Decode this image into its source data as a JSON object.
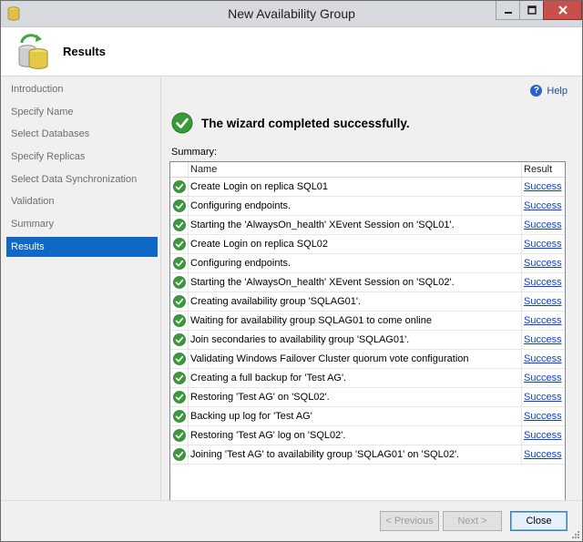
{
  "window": {
    "title": "New Availability Group"
  },
  "header": {
    "title": "Results"
  },
  "sidebar": {
    "items": [
      {
        "label": "Introduction",
        "selected": false
      },
      {
        "label": "Specify Name",
        "selected": false
      },
      {
        "label": "Select Databases",
        "selected": false
      },
      {
        "label": "Specify Replicas",
        "selected": false
      },
      {
        "label": "Select Data Synchronization",
        "selected": false
      },
      {
        "label": "Validation",
        "selected": false
      },
      {
        "label": "Summary",
        "selected": false
      },
      {
        "label": "Results",
        "selected": true
      }
    ]
  },
  "main": {
    "help_label": "Help",
    "success_message": "The wizard completed successfully.",
    "summary_label": "Summary:",
    "columns": {
      "name": "Name",
      "result": "Result"
    },
    "rows": [
      {
        "name": "Create Login on replica SQL01",
        "result": "Success"
      },
      {
        "name": "Configuring endpoints.",
        "result": "Success"
      },
      {
        "name": "Starting the 'AlwaysOn_health' XEvent Session on 'SQL01'.",
        "result": "Success"
      },
      {
        "name": "Create Login on replica SQL02",
        "result": "Success"
      },
      {
        "name": "Configuring endpoints.",
        "result": "Success"
      },
      {
        "name": "Starting the 'AlwaysOn_health' XEvent Session on 'SQL02'.",
        "result": "Success"
      },
      {
        "name": "Creating availability group 'SQLAG01'.",
        "result": "Success"
      },
      {
        "name": "Waiting for availability group SQLAG01 to come online",
        "result": "Success"
      },
      {
        "name": "Join secondaries to availability group 'SQLAG01'.",
        "result": "Success"
      },
      {
        "name": "Validating Windows Failover Cluster quorum vote configuration",
        "result": "Success"
      },
      {
        "name": "Creating a full backup for 'Test AG'.",
        "result": "Success"
      },
      {
        "name": "Restoring 'Test AG' on 'SQL02'.",
        "result": "Success"
      },
      {
        "name": "Backing up log for 'Test AG'",
        "result": "Success"
      },
      {
        "name": "Restoring 'Test AG' log on 'SQL02'.",
        "result": "Success"
      },
      {
        "name": "Joining 'Test AG' to availability group 'SQLAG01' on 'SQL02'.",
        "result": "Success"
      }
    ]
  },
  "footer": {
    "previous_label": "< Previous",
    "next_label": "Next >",
    "close_label": "Close"
  },
  "colors": {
    "selected_nav": "#0f67c6",
    "success_green": "#3a9a3a",
    "link_blue": "#0b3ed6",
    "close_button_red": "#c7504b"
  },
  "icons": {
    "app": "database-icon",
    "header": "database-refresh-icon",
    "status": "green-check-icon",
    "help": "help-icon"
  }
}
